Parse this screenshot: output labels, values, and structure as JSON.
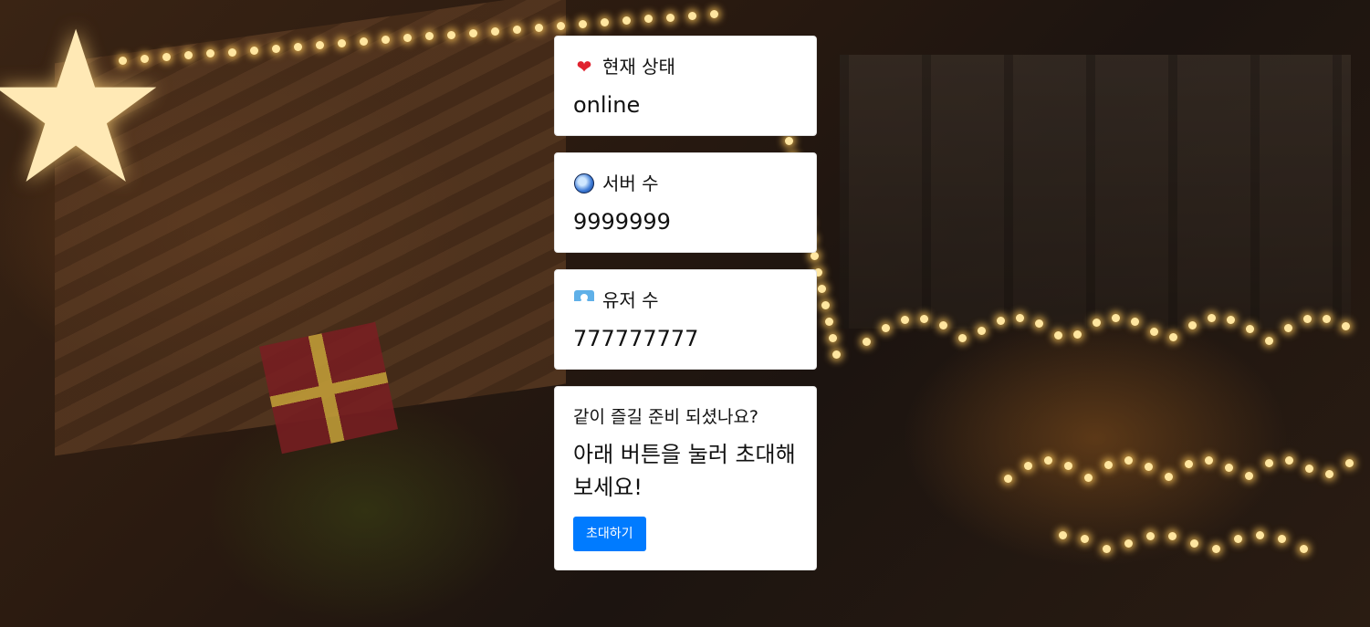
{
  "status_card": {
    "icon": "heart-icon",
    "label": "현재 상태",
    "value": "online"
  },
  "servers_card": {
    "icon": "gem-icon",
    "label": "서버 수",
    "value": "9999999"
  },
  "users_card": {
    "icon": "snowman-icon",
    "label": "유저 수",
    "value": "777777777"
  },
  "invite_card": {
    "subtitle": "같이 즐길 준비 되셨나요?",
    "message": "아래 버튼을 눌러 초대해보세요!",
    "button_label": "초대하기"
  },
  "colors": {
    "button": "#007bff",
    "card": "#ffffff",
    "heart": "#e0222e"
  }
}
